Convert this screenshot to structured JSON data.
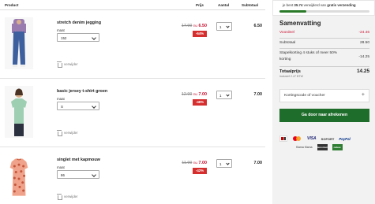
{
  "table": {
    "col_product": "Product",
    "col_prijs": "Prijs",
    "col_aantal": "Aantal",
    "col_subtotaal": "Subtotaal"
  },
  "items": [
    {
      "name": "stretch denim jegging",
      "size_label": "maat",
      "size_value": "152",
      "old_price": "17.99",
      "nu": "nu",
      "new_price": "6.50",
      "discount": "-64%",
      "quantity": "1",
      "subtotal": "6.50",
      "remove_label": "verwijder",
      "image_icon": "product-jeans"
    },
    {
      "name": "basic jersey t-shirt groen",
      "size_label": "maat",
      "size_value": "S",
      "old_price": "12.99",
      "nu": "nu",
      "new_price": "7.00",
      "discount": "-46%",
      "quantity": "1",
      "subtotal": "7.00",
      "remove_label": "verwijder",
      "image_icon": "product-tshirt"
    },
    {
      "name": "singlet met kapmouw",
      "size_label": "maat",
      "size_value": "86",
      "old_price": "11.99",
      "nu": "nu",
      "new_price": "7.00",
      "discount": "-42%",
      "quantity": "1",
      "subtotal": "7.00",
      "remove_label": "verwijder",
      "image_icon": "product-singlet"
    }
  ],
  "shipping_banner": {
    "prefix": "je bent",
    "amount": "35.74",
    "middle": "verwijderd van",
    "highlight": "gratis verzending",
    "progress_fraction": 0.3,
    "color": "#2a7a2a"
  },
  "summary": {
    "title": "Samenvatting",
    "voordeel_label": "Voordeel",
    "voordeel_value": "-24.46",
    "subtotaal_label": "Subtotaal",
    "subtotaal_value": "28.50",
    "staffel_label_1": "Stapelkorting 4 stuks of meer 50%",
    "staffel_label_2": "korting",
    "staffel_value": "-14.25",
    "total_label": "Totaalprijs",
    "total_value": "14.25",
    "btw_note": "inclusief 2.47 BTW",
    "voucher_label": "Kortingscode of voucher",
    "checkout_label": "Ga door naar afrekenen",
    "checkout_color": "#1f6d2b",
    "discount_color": "#c8102e"
  },
  "payment_methods": {
    "row1": [
      "ideal-icon",
      "mastercard-icon",
      "VISA",
      "SOFORT",
      "PayPal"
    ],
    "row2": [
      "Klarna",
      "bancontact-icon",
      "giftcard-icon"
    ]
  },
  "payment_labels": {
    "visa": "VISA",
    "sofort": "SOFORT",
    "paypal": "PayPal",
    "klarna": "Klarna Klarna",
    "box1": "Bancontact",
    "box2": "cadeau"
  }
}
